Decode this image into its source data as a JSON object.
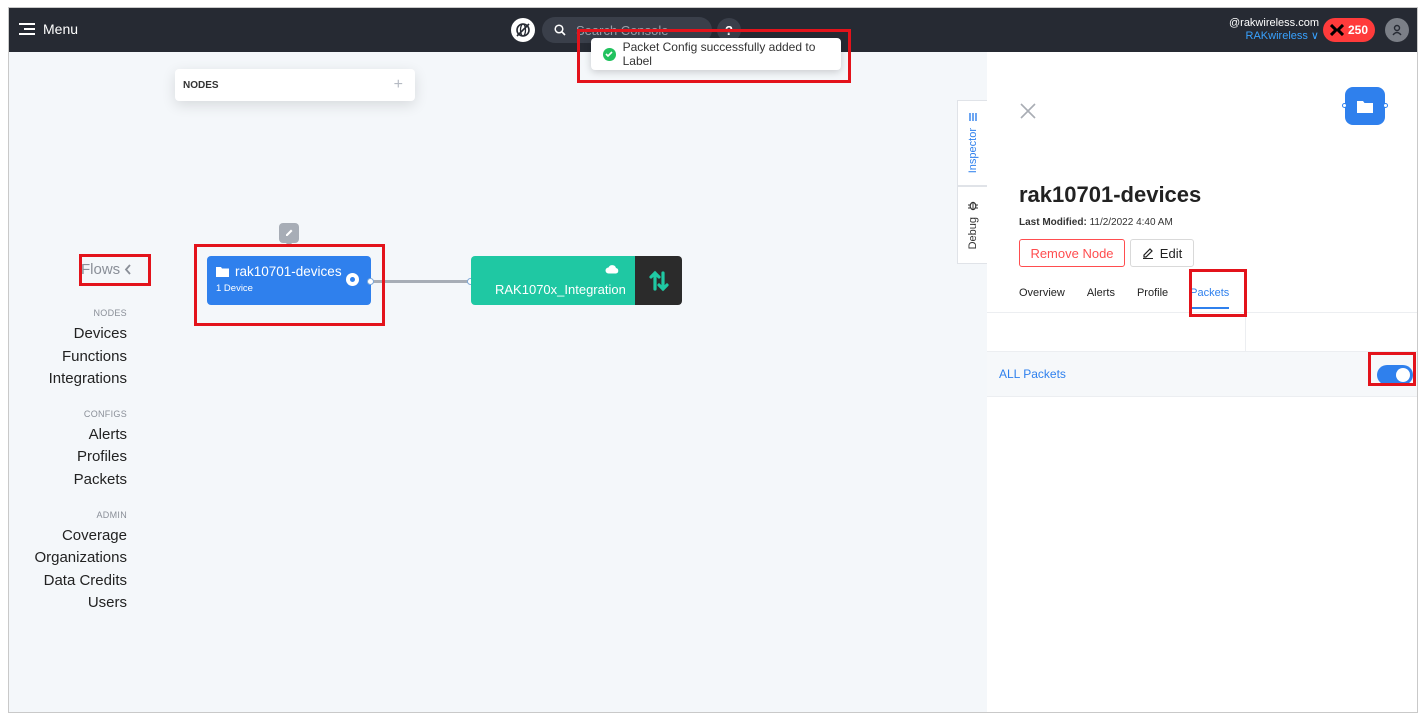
{
  "topbar": {
    "menu_label": "Menu",
    "search_placeholder": "Search Console",
    "help_label": "?",
    "account_email": "@rakwireless.com",
    "account_org": "RAKwireless ∨",
    "credits": "250"
  },
  "toast": {
    "message": "Packet Config successfully added to Label"
  },
  "nodes_panel": {
    "title": "NODES",
    "add_label": "+"
  },
  "sidebar": {
    "flows_label": "Flows",
    "sections": [
      {
        "title": "NODES",
        "items": [
          "Devices",
          "Functions",
          "Integrations"
        ]
      },
      {
        "title": "CONFIGS",
        "items": [
          "Alerts",
          "Profiles",
          "Packets"
        ]
      },
      {
        "title": "ADMIN",
        "items": [
          "Coverage",
          "Organizations",
          "Data Credits",
          "Users"
        ]
      }
    ]
  },
  "flow": {
    "device_node": {
      "name": "rak10701-devices",
      "count": "1 Device"
    },
    "integration_node": {
      "name": "RAK1070x_Integration"
    }
  },
  "side_tabs": {
    "inspector": "Inspector",
    "debug": "Debug"
  },
  "inspector": {
    "title": "rak10701-devices",
    "modified_label": "Last Modified:",
    "modified_value": "11/2/2022 4:40 AM",
    "remove_label": "Remove Node",
    "edit_label": "Edit",
    "tabs": [
      "Overview",
      "Alerts",
      "Profile",
      "Packets"
    ],
    "active_tab": "Packets",
    "packets_row_label": "ALL Packets",
    "packets_toggle_on": true
  },
  "colors": {
    "topbar": "#262a33",
    "accent": "#2f80ed",
    "integration": "#1fc8a3",
    "danger": "#ff4d4f",
    "annotation": "#e3131b"
  }
}
